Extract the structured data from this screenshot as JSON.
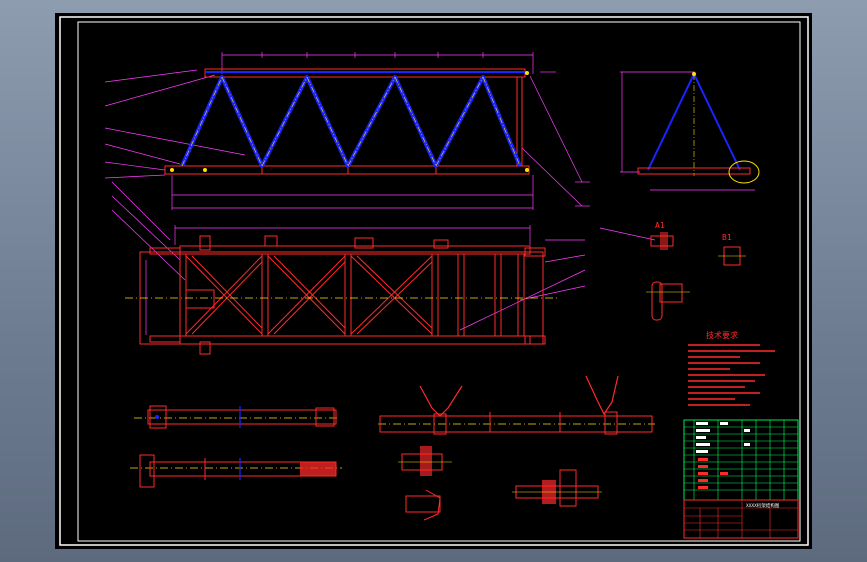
{
  "drawing": {
    "background_color": "#000000",
    "frame_color": "#ffffff",
    "steel_outline_color": "#ff2a2a",
    "truss_member_color": "#1a24ff",
    "dimension_color": "#ff3cff",
    "center_line_color": "#ffff00",
    "hatch_color": "#ffe100",
    "table_line_color": "#00ff5a"
  },
  "views": {
    "detail_mark_left": "A1",
    "detail_mark_right": "B1"
  },
  "notes": {
    "heading": "技术要求"
  },
  "title_block": {
    "title": "XXXX桁架结构图"
  }
}
